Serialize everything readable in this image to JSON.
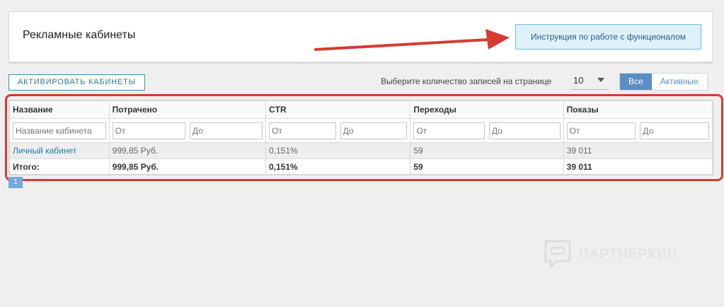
{
  "header": {
    "title": "Рекламные кабинеты",
    "instruction_button": "Инструкция по работе с функционалом"
  },
  "toolbar": {
    "activate_button": "АКТИВИРОВАТЬ КАБИНЕТЫ",
    "per_page_label": "Выберите количество записей на странице",
    "per_page_value": "10",
    "filter_all": "Все",
    "filter_active": "Активные"
  },
  "table": {
    "columns": [
      "Название",
      "Потрачено",
      "CTR",
      "Переходы",
      "Показы"
    ],
    "filters": {
      "name_placeholder": "Название кабинета",
      "from_placeholder": "От",
      "to_placeholder": "До"
    },
    "rows": [
      {
        "name": "Личный кабинет",
        "spent": "999,85  Руб.",
        "ctr": "0,151%",
        "clicks": "59",
        "impressions": "39 011"
      }
    ],
    "total": {
      "label": "Итого:",
      "spent": "999,85  Руб.",
      "ctr": "0,151%",
      "clicks": "59",
      "impressions": "39 011"
    }
  },
  "pagination": {
    "current_page": "1"
  },
  "watermark": {
    "text": "ПАРТНЕРКИН"
  },
  "colors": {
    "accent": "#5b8ec3",
    "highlight": "#d63a32",
    "link": "#1d7aa8"
  },
  "icons": [
    "dropdown-caret-icon",
    "arrow-annotation-icon",
    "watermark-logo-icon"
  ]
}
